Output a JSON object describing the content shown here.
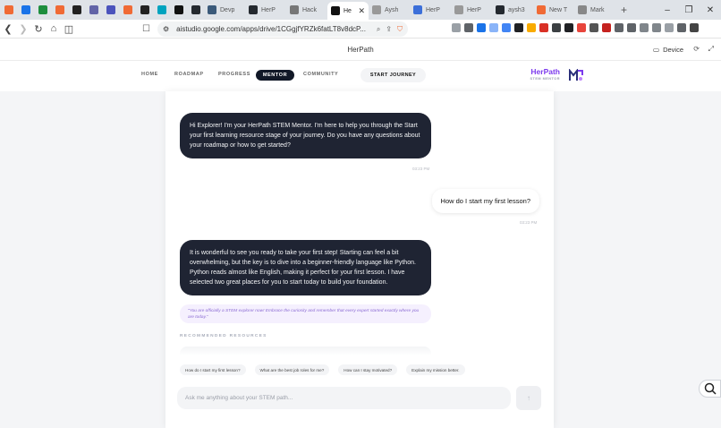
{
  "browser": {
    "tabs": [
      {
        "label": "",
        "color": "#f06a35"
      },
      {
        "label": "",
        "color": "#1a73e8"
      },
      {
        "label": "",
        "color": "#1e8e3e"
      },
      {
        "label": "",
        "color": "#f06a35"
      },
      {
        "label": "",
        "color": "#222222"
      },
      {
        "label": "",
        "color": "#6264a7"
      },
      {
        "label": "",
        "color": "#4b53bc"
      },
      {
        "label": "",
        "color": "#f06a35"
      },
      {
        "label": "",
        "color": "#222222"
      },
      {
        "label": "",
        "color": "#00a3bf"
      },
      {
        "label": "",
        "color": "#111111"
      },
      {
        "label": "",
        "color": "#24292f"
      },
      {
        "label": "Devp",
        "color": "#3b5a7a"
      },
      {
        "label": "HerP",
        "color": "#24292f"
      },
      {
        "label": "Hack",
        "color": "#777777"
      },
      {
        "label": "He",
        "color": "#111111",
        "active": true
      },
      {
        "label": "Aysh",
        "color": "#999999"
      },
      {
        "label": "HerP",
        "color": "#3c6fd9"
      },
      {
        "label": "HerP",
        "color": "#999999"
      },
      {
        "label": "aysh3",
        "color": "#24292f"
      },
      {
        "label": "New T",
        "color": "#f06a35"
      },
      {
        "label": "Mark",
        "color": "#888888"
      }
    ],
    "new_tab": "+",
    "url": "aistudio.google.com/apps/drive/1CGgjfYRZk6fatLT8v8dcP...",
    "window_controls": {
      "minimize": "–",
      "maximize": "❐",
      "close": "✕"
    }
  },
  "app_header": {
    "title": "HerPath",
    "device_label": "Device"
  },
  "nav": {
    "items": [
      "HOME",
      "ROADMAP",
      "PROGRESS",
      "MENTOR",
      "COMMUNITY"
    ],
    "active": "MENTOR",
    "cta": "START JOURNEY",
    "logo_name": "HerPath",
    "logo_sub": "STEM MENTOR"
  },
  "chat": {
    "messages": [
      {
        "role": "mentor",
        "text": "Hi Explorer! I'm your HerPath STEM Mentor. I'm here to help you through the Start your first learning resource stage of your journey. Do you have any questions about your roadmap or how to get started?",
        "time": "03:23 PM"
      },
      {
        "role": "user",
        "text": "How do I start my first lesson?",
        "time": "03:23 PM"
      },
      {
        "role": "mentor",
        "text": "It is wonderful to see you ready to take your first step! Starting can feel a bit overwhelming, but the key is to dive into a beginner-friendly language like Python. Python reads almost like English, making it perfect for your first lesson. I have selected two great places for you to start today to build your foundation."
      }
    ],
    "quote": "\"You are officially a STEM explorer now! Embrace the curiosity and remember that every expert started exactly where you are today.\"",
    "recommended_heading": "RECOMMENDED RESOURCES",
    "suggestions": [
      "How do I start my first lesson?",
      "What are the best job roles for me?",
      "How can I stay motivated?",
      "Explain my mission better."
    ],
    "input_placeholder": "Ask me anything about your STEM path...",
    "send_icon": "arrow-up-icon"
  },
  "colors": {
    "bubble_dark": "#1f2433",
    "nav_active": "#111827",
    "brand_purple": "#7c3aed",
    "quote_text": "#8b6bd3"
  }
}
